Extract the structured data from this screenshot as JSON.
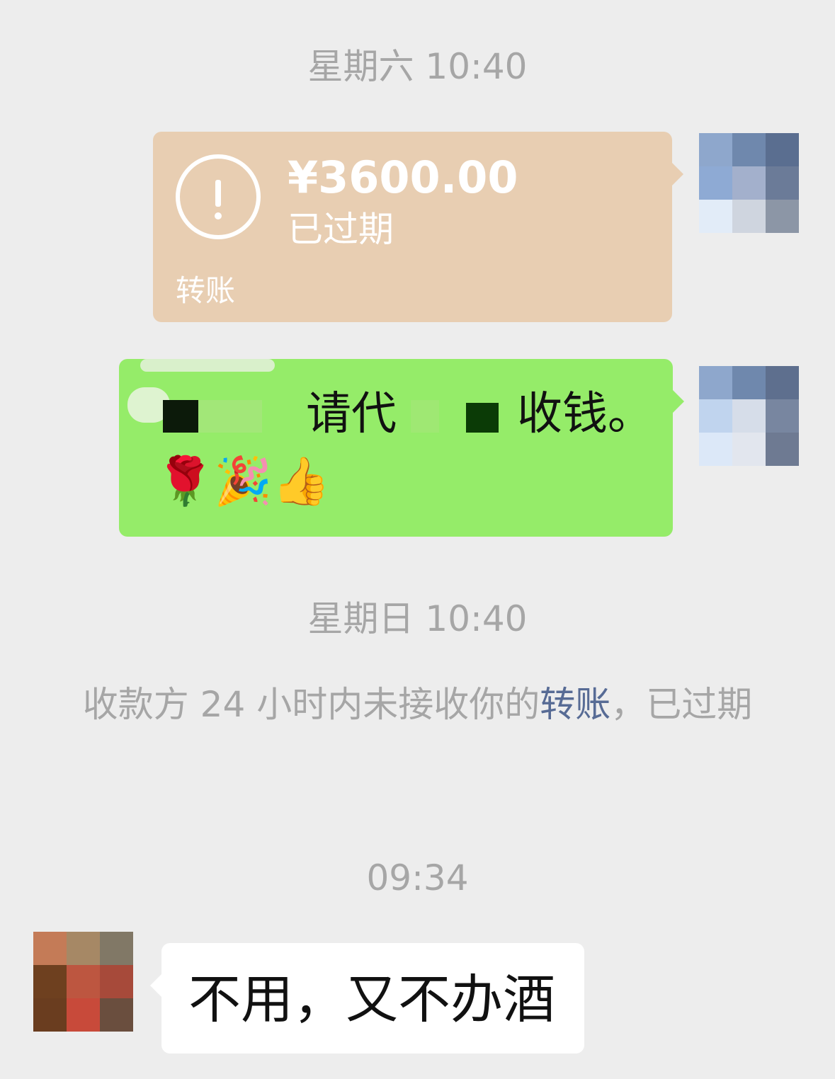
{
  "chat": {
    "timestamp_1": "星期六 10:40",
    "transfer": {
      "amount": "¥3600.00",
      "status": "已过期",
      "kind": "转账",
      "icon": "exclamation-circle-icon",
      "color": "#e8ceb2"
    },
    "outgoing_message": {
      "part_1": "请代",
      "part_2": "收钱。",
      "emojis": "🌹🎉👍",
      "color": "#95ec69"
    },
    "timestamp_2": "星期日 10:40",
    "system_notice": {
      "prefix": "收款方 24 小时内未接收你的",
      "link": "转账",
      "suffix": "，已过期"
    },
    "timestamp_3": "09:34",
    "incoming_message": {
      "text": "不用，又不办酒"
    }
  }
}
